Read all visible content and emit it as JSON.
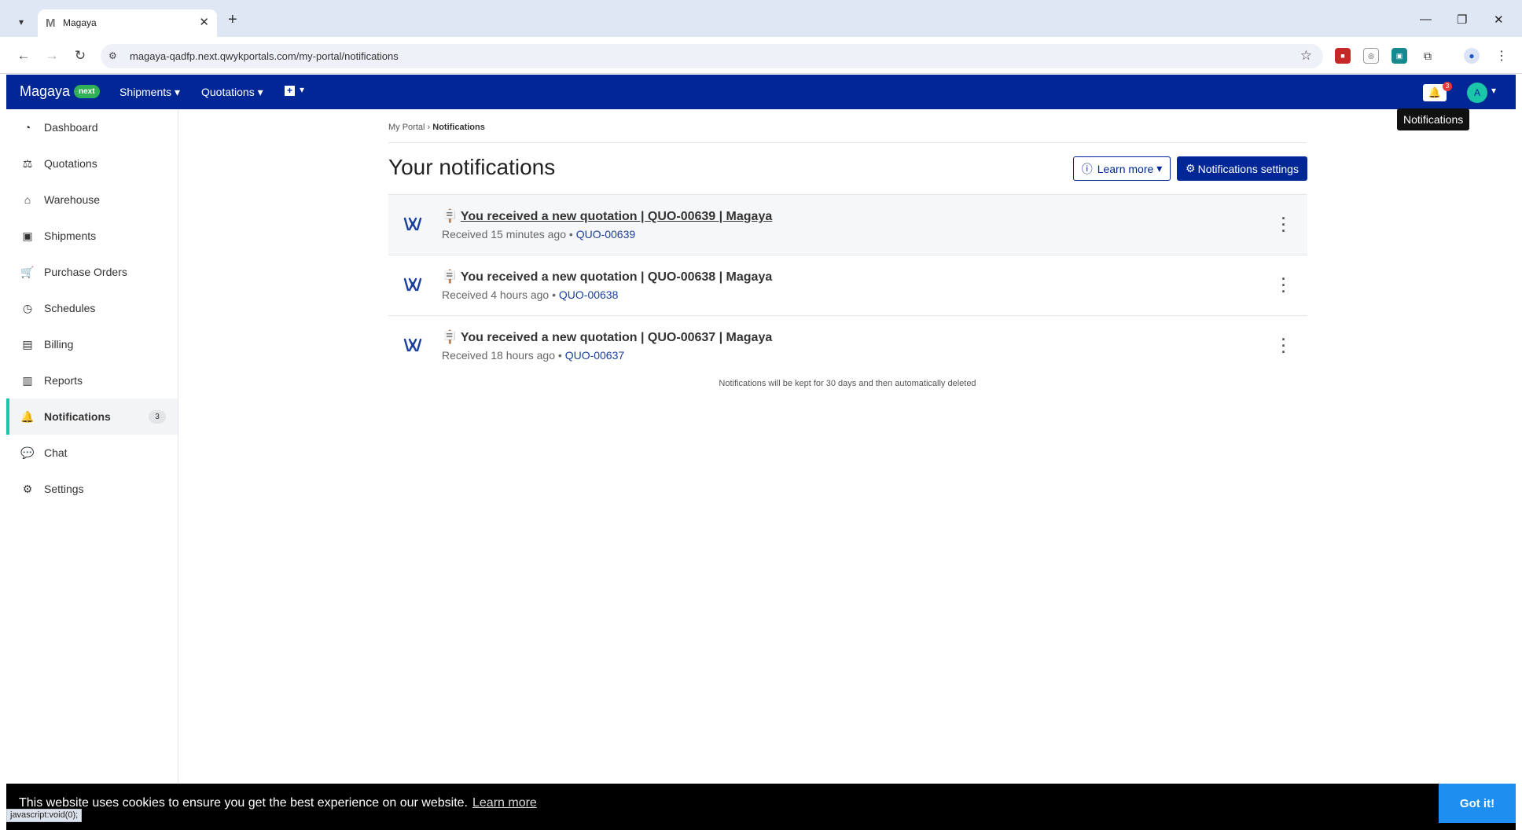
{
  "browser": {
    "tab_title": "Magaya",
    "url": "magaya-qadfp.next.qwykportals.com/my-portal/notifications",
    "status_url": "javascript:void(0);"
  },
  "header": {
    "brand": "Magaya",
    "brand_badge": "next",
    "nav": [
      "Shipments",
      "Quotations"
    ],
    "notifications_count": "3",
    "avatar_initial": "A",
    "tooltip": "Notifications",
    "accent_color": "#012695"
  },
  "sidebar": {
    "items": [
      {
        "label": "Dashboard",
        "icon": "dashboard-icon"
      },
      {
        "label": "Quotations",
        "icon": "quotations-icon"
      },
      {
        "label": "Warehouse",
        "icon": "warehouse-icon"
      },
      {
        "label": "Shipments",
        "icon": "shipments-icon"
      },
      {
        "label": "Purchase Orders",
        "icon": "cart-icon"
      },
      {
        "label": "Schedules",
        "icon": "clock-icon"
      },
      {
        "label": "Billing",
        "icon": "billing-icon"
      },
      {
        "label": "Reports",
        "icon": "chart-icon"
      },
      {
        "label": "Notifications",
        "icon": "bell-icon",
        "count": "3",
        "active": true
      },
      {
        "label": "Chat",
        "icon": "chat-icon"
      },
      {
        "label": "Settings",
        "icon": "gear-icon"
      }
    ]
  },
  "main": {
    "breadcrumb_root": "My Portal",
    "breadcrumb_current": "Notifications",
    "title": "Your notifications",
    "learn_more": "Learn more",
    "settings_button": "Notifications settings",
    "notifications": [
      {
        "title": "You received a new quotation | QUO-00639 | Magaya",
        "received": "Received 15 minutes ago",
        "ref": "QUO-00639"
      },
      {
        "title": "You received a new quotation | QUO-00638 | Magaya",
        "received": "Received 4 hours ago",
        "ref": "QUO-00638"
      },
      {
        "title": "You received a new quotation | QUO-00637 | Magaya",
        "received": "Received 18 hours ago",
        "ref": "QUO-00637"
      }
    ],
    "retention_note": "Notifications will be kept for 30 days and then automatically deleted"
  },
  "cookie": {
    "text": "This website uses cookies to ensure you get the best experience on our website.",
    "link": "Learn more",
    "button": "Got it!"
  }
}
